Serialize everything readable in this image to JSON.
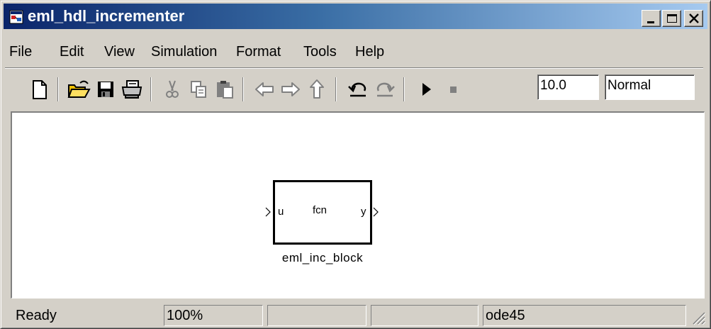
{
  "window": {
    "title": "eml_hdl_incrementer",
    "controls": {
      "minimize": "minimize-icon",
      "maximize": "maximize-icon",
      "close": "close-icon"
    }
  },
  "menu": [
    "File",
    "Edit",
    "View",
    "Simulation",
    "Format",
    "Tools",
    "Help"
  ],
  "toolbar": {
    "buttons": [
      "new-document-icon",
      "open-folder-icon",
      "save-icon",
      "print-icon",
      "cut-icon",
      "copy-icon",
      "paste-icon",
      "back-arrow-icon",
      "forward-arrow-icon",
      "up-arrow-icon",
      "undo-icon",
      "redo-icon",
      "play-icon",
      "stop-icon"
    ],
    "stop_time": "10.0",
    "sim_mode": "Normal"
  },
  "model": {
    "block": {
      "function_name": "fcn",
      "input_port": "u",
      "output_port": "y",
      "name": "eml_inc_block"
    }
  },
  "status": {
    "state": "Ready",
    "zoom": "100%",
    "solver": "ode45"
  },
  "colors": {
    "title_gradient_start": "#0a246a",
    "title_gradient_end": "#a6caf0",
    "chrome": "#d4d0c8",
    "canvas": "#ffffff"
  }
}
